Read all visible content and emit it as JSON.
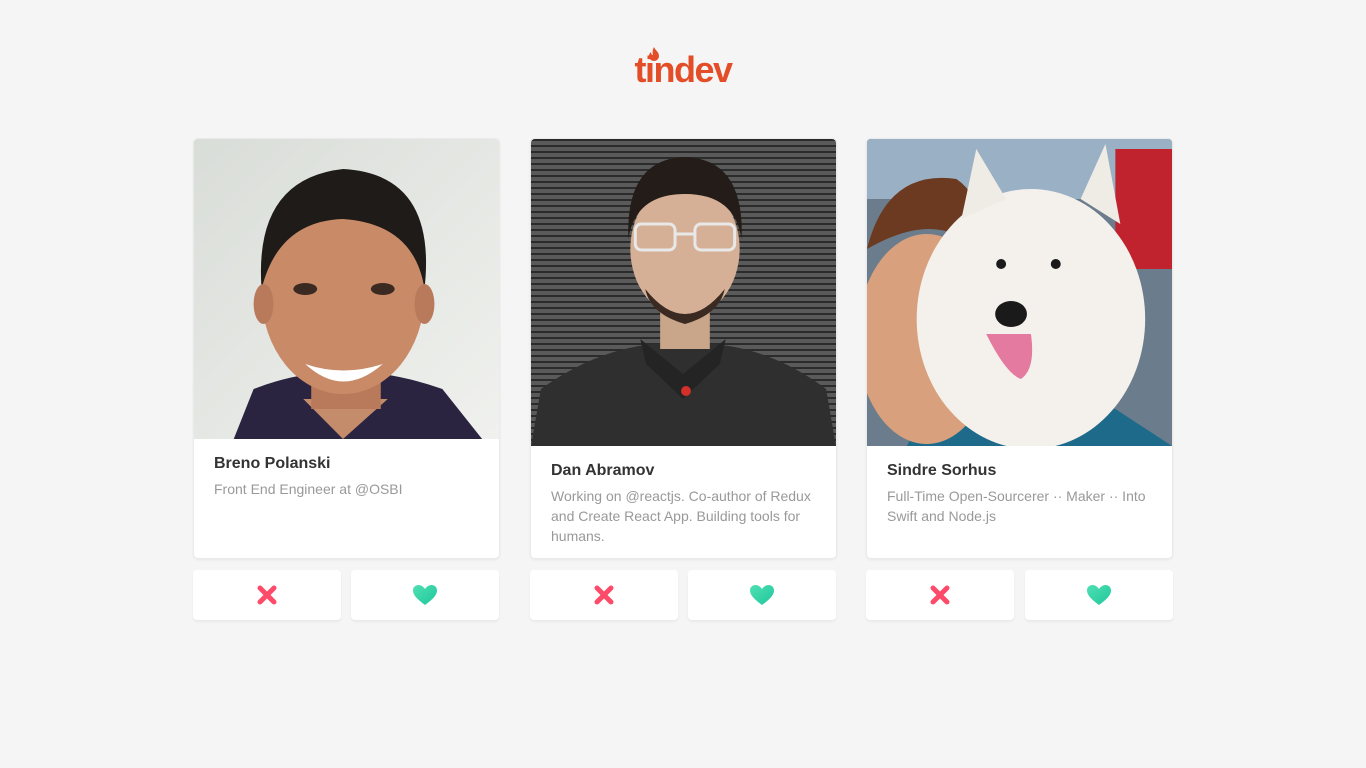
{
  "app": {
    "logo_text": "tindev",
    "brand_color": "#e34d28"
  },
  "developers": [
    {
      "name": "Breno Polanski",
      "bio": "Front End Engineer at @OSBI",
      "avatar": "portrait-photo-smiling-man"
    },
    {
      "name": "Dan Abramov",
      "bio": "Working on @reactjs. Co-author of Redux and Create React App. Building tools for humans.",
      "avatar": "portrait-photo-man-with-glasses"
    },
    {
      "name": "Sindre Sorhus",
      "bio": "Full-Time Open-Sourcerer ·· Maker ·· Into Swift and Node.js",
      "avatar": "portrait-photo-man-with-white-dog"
    }
  ],
  "actions": {
    "dislike_icon": "x-icon",
    "like_icon": "heart-icon",
    "dislike_color": "#ff4b6a",
    "like_color": "#2fd8aa"
  }
}
